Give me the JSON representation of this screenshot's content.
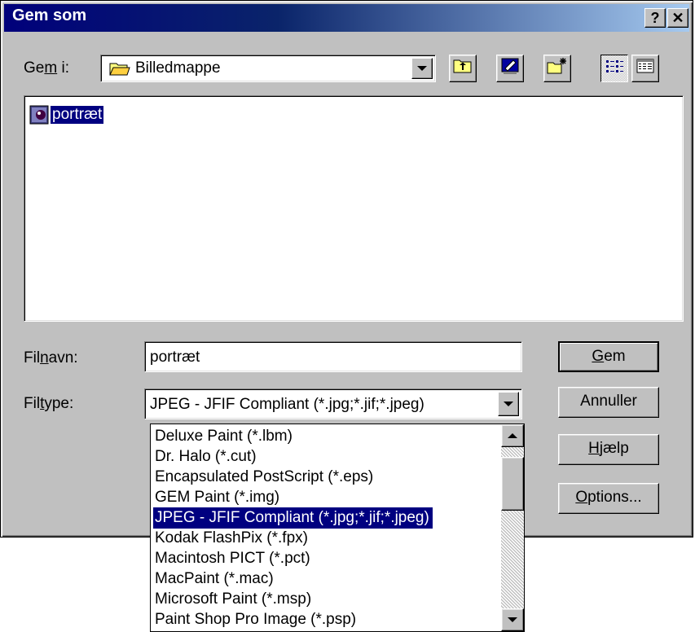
{
  "window": {
    "title": "Gem som",
    "help_button": "?",
    "close_button": "✕"
  },
  "location": {
    "label_pre": "Ge",
    "label_u": "m",
    "label_post": " i:",
    "value": "Billedmappe"
  },
  "toolbar": {
    "icons": [
      "up-one-level-icon",
      "desktop-icon",
      "new-folder-icon",
      "list-view-icon",
      "details-view-icon"
    ]
  },
  "files": [
    {
      "name": "portræt",
      "icon": "image-file-icon",
      "selected": true
    }
  ],
  "filename": {
    "label_pre": "Fil",
    "label_u": "n",
    "label_post": "avn:",
    "value": "portræt"
  },
  "filetype": {
    "label_pre": "Fil",
    "label_u": "t",
    "label_post": "ype:",
    "value": "JPEG - JFIF Compliant (*.jpg;*.jif;*.jpeg)",
    "options": [
      "Deluxe Paint (*.lbm)",
      "Dr. Halo (*.cut)",
      "Encapsulated PostScript (*.eps)",
      "GEM Paint (*.img)",
      "JPEG - JFIF Compliant (*.jpg;*.jif;*.jpeg)",
      "Kodak FlashPix (*.fpx)",
      "Macintosh PICT (*.pct)",
      "MacPaint (*.mac)",
      "Microsoft Paint (*.msp)",
      "Paint Shop Pro Image (*.psp)"
    ],
    "selected_index": 4
  },
  "buttons": {
    "save_u": "G",
    "save_rest": "em",
    "cancel": "Annuller",
    "help_u": "H",
    "help_rest": "jælp",
    "options_u": "O",
    "options_rest": "ptions..."
  },
  "colors": {
    "titlebar": "#00007b",
    "selection": "#000080",
    "face": "#c0c0c0"
  }
}
